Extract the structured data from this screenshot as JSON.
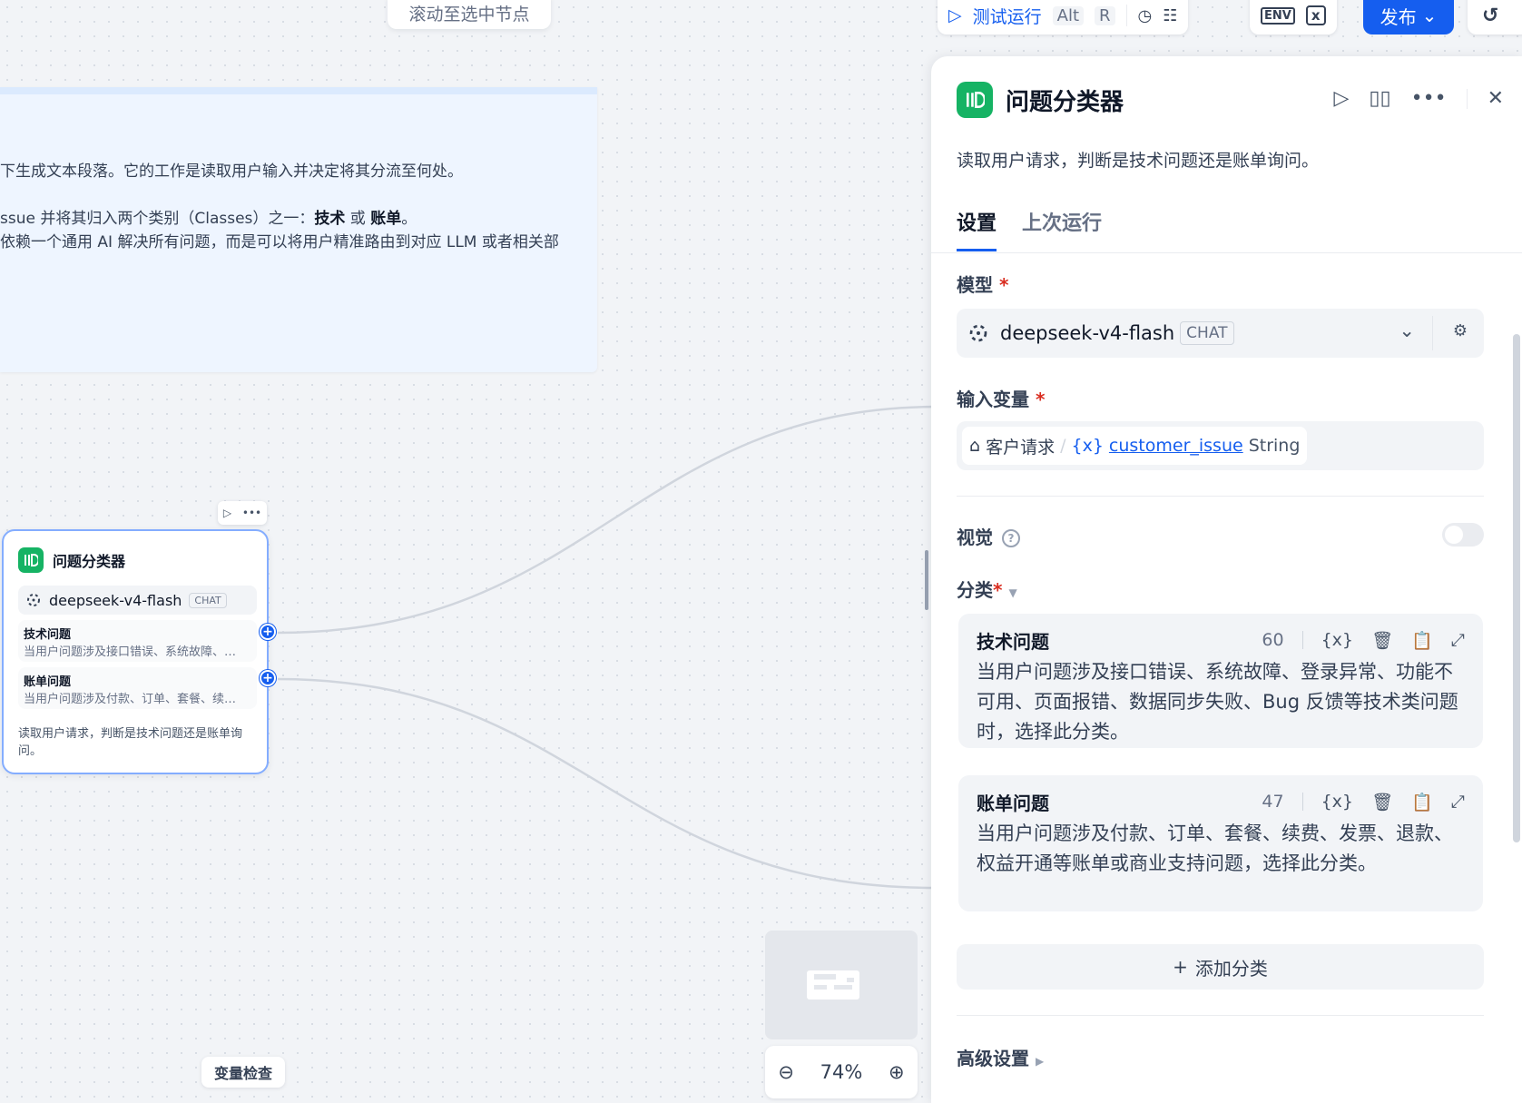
{
  "canvas": {
    "scroll_to_selected": "滚动至选中节点",
    "note": {
      "line1": "下生成文本段落。它的工作是读取用户输入并决定将其分流至何处。",
      "line2_pre": "ssue 并将其归入两个类别（Classes）之一：",
      "line2_b1": "技术",
      "line2_mid": " 或 ",
      "line2_b2": "账单",
      "line2_post": "。",
      "line3": "依赖一个通用 AI 解决所有问题，而是可以将用户精准路由到对应 LLM 或者相关部"
    },
    "node": {
      "title": "问题分类器",
      "model": "deepseek-v4-flash",
      "model_badge": "CHAT",
      "classes": [
        {
          "title": "技术问题",
          "desc": "当用户问题涉及接口错误、系统故障、登录异常、功能不可用"
        },
        {
          "title": "账单问题",
          "desc": "当用户问题涉及付款、订单、套餐、续费、发票、退款"
        }
      ],
      "description": "读取用户请求，判断是技术问题还是账单询问。"
    },
    "variable_inspect": "变量检查",
    "zoom_level": "74%"
  },
  "toolbar": {
    "test_run": "测试运行",
    "shortcut_alt": "Alt",
    "shortcut_r": "R",
    "env_label": "ENV",
    "publish": "发布"
  },
  "panel": {
    "title": "问题分类器",
    "description": "读取用户请求，判断是技术问题还是账单询问。",
    "tabs": [
      {
        "label": "设置",
        "active": true
      },
      {
        "label": "上次运行",
        "active": false
      }
    ],
    "model_label": "模型",
    "model_name": "deepseek-v4-flash",
    "model_badge": "CHAT",
    "input_var_label": "输入变量",
    "input_var": {
      "node": "客户请求",
      "separator": "/",
      "prefix": "{x}",
      "name": "customer_issue",
      "type": "String"
    },
    "vision_label": "视觉",
    "vision_enabled": false,
    "class_label": "分类",
    "classes": [
      {
        "title": "技术问题",
        "count": "60",
        "body": "当用户问题涉及接口错误、系统故障、登录异常、功能不可用、页面报错、数据同步失败、Bug 反馈等技术类问题时，选择此分类。"
      },
      {
        "title": "账单问题",
        "count": "47",
        "body": "当用户问题涉及付款、订单、套餐、续费、发票、退款、权益开通等账单或商业支持问题，选择此分类。"
      }
    ],
    "add_class": "添加分类",
    "advanced_settings": "高级设置"
  },
  "colors": {
    "accent": "#155eef",
    "node_icon": "#16b364"
  }
}
